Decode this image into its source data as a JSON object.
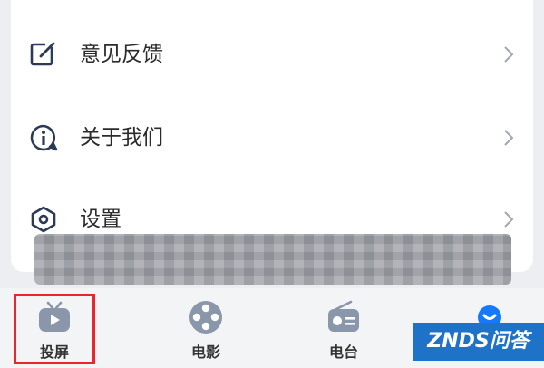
{
  "menu": {
    "items": [
      {
        "label": "意见反馈",
        "icon": "edit-icon"
      },
      {
        "label": "关于我们",
        "icon": "info-icon"
      },
      {
        "label": "设置",
        "icon": "settings-icon"
      }
    ]
  },
  "tabbar": {
    "tabs": [
      {
        "label": "投屏",
        "icon": "tv-play-icon",
        "selected": true
      },
      {
        "label": "电影",
        "icon": "film-reel-icon"
      },
      {
        "label": "电台",
        "icon": "radio-icon"
      },
      {
        "label": "",
        "icon": "profile-icon"
      }
    ]
  },
  "watermark": {
    "text": "ZNDS问答"
  },
  "colors": {
    "highlight": "#e8262b",
    "icon_dark": "#2c3a55",
    "tab_icon": "#8a96aa",
    "tab_active_icon": "#1677ff",
    "watermark_bg": "#1e73c8"
  }
}
